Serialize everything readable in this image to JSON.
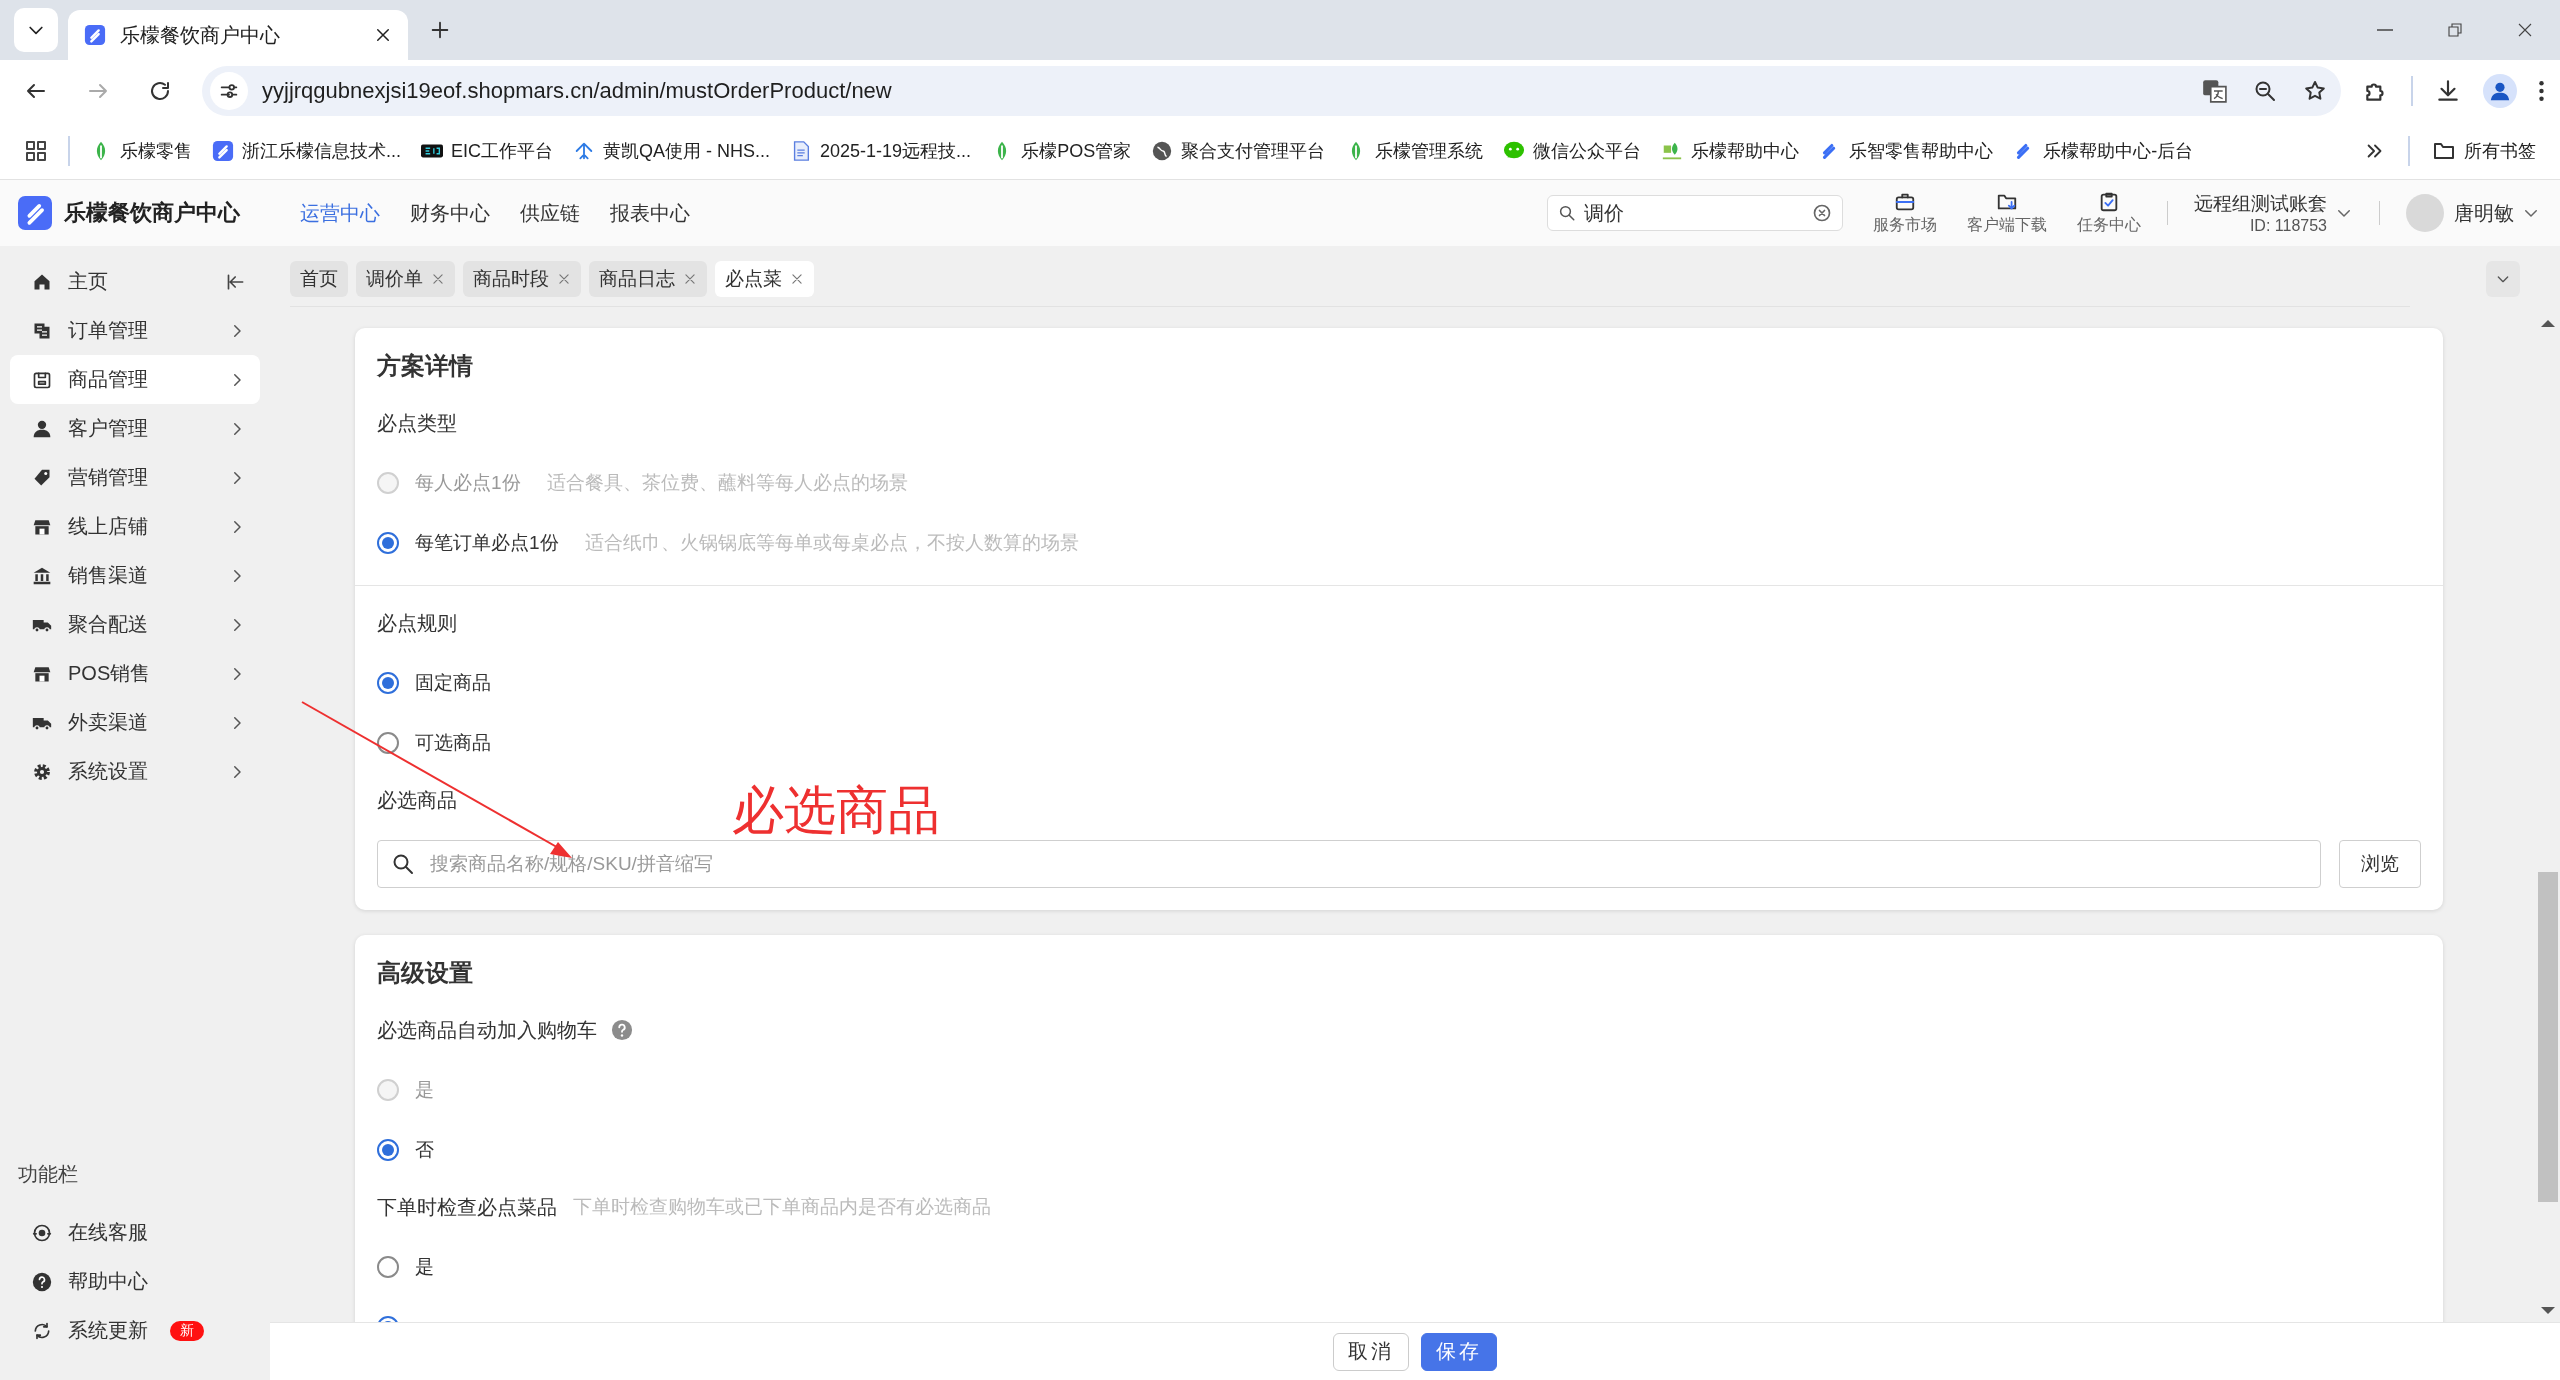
{
  "browser": {
    "tabs": [
      {
        "title": "乐檬餐饮商户中心",
        "selected": true
      }
    ],
    "url": "yyjjrqgubnexjsi19eof.shopmars.cn/admin/mustOrderProduct/new",
    "bookmarks": [
      "乐檬零售",
      "浙江乐檬信息技术...",
      "EIC工作平台",
      "黄凯QA使用 - NHS...",
      "2025-1-19远程技...",
      "乐檬POS管家",
      "聚合支付管理平台",
      "乐檬管理系统",
      "微信公众平台",
      "乐檬帮助中心",
      "乐智零售帮助中心",
      "乐檬帮助中心-后台"
    ],
    "all_bookmarks": "所有书签"
  },
  "header": {
    "brand": "乐檬餐饮商户中心",
    "nav": [
      {
        "label": "运营中心",
        "selected": true
      },
      {
        "label": "财务中心",
        "selected": false
      },
      {
        "label": "供应链",
        "selected": false
      },
      {
        "label": "报表中心",
        "selected": false
      }
    ],
    "search": {
      "value": "调价"
    },
    "tools": [
      "服务市场",
      "客户端下载",
      "任务中心"
    ],
    "account": {
      "name": "远程组测试账套",
      "id": "ID: 118753"
    },
    "user": "唐明敏"
  },
  "sidebar": {
    "items": [
      {
        "label": "主页",
        "kind": "link",
        "selected": false
      },
      {
        "label": "订单管理",
        "kind": "menu",
        "selected": false
      },
      {
        "label": "商品管理",
        "kind": "menu",
        "selected": true
      },
      {
        "label": "客户管理",
        "kind": "menu",
        "selected": false
      },
      {
        "label": "营销管理",
        "kind": "menu",
        "selected": false
      },
      {
        "label": "线上店铺",
        "kind": "menu",
        "selected": false
      },
      {
        "label": "销售渠道",
        "kind": "menu",
        "selected": false
      },
      {
        "label": "聚合配送",
        "kind": "menu",
        "selected": false
      },
      {
        "label": "POS销售",
        "kind": "menu",
        "selected": false
      },
      {
        "label": "外卖渠道",
        "kind": "menu",
        "selected": false
      },
      {
        "label": "系统设置",
        "kind": "menu",
        "selected": false
      }
    ],
    "section_title": "功能栏",
    "footer_items": [
      {
        "label": "在线客服"
      },
      {
        "label": "帮助中心"
      },
      {
        "label": "系统更新",
        "badge": "新"
      }
    ]
  },
  "page_tabs": [
    {
      "label": "首页",
      "selected": false,
      "closable": false
    },
    {
      "label": "调价单",
      "selected": false,
      "closable": true
    },
    {
      "label": "商品时段",
      "selected": false,
      "closable": true
    },
    {
      "label": "商品日志",
      "selected": false,
      "closable": true
    },
    {
      "label": "必点菜",
      "selected": true,
      "closable": true
    }
  ],
  "cards": [
    {
      "title": "方案详情",
      "groups": [
        {
          "kind": "radio_group",
          "label": "必点类型",
          "options": [
            {
              "label": "每人必点1份",
              "hint": "适合餐具、茶位费、蘸料等每人必点的场景",
              "selected": false,
              "disabled": true
            },
            {
              "label": "每笔订单必点1份",
              "hint": "适合纸巾、火锅锅底等每单或每桌必点，不按人数算的场景",
              "selected": true,
              "disabled": false
            }
          ]
        },
        {
          "kind": "divider"
        },
        {
          "kind": "radio_group",
          "label": "必点规则",
          "options": [
            {
              "label": "固定商品",
              "selected": true,
              "disabled": false
            },
            {
              "label": "可选商品",
              "selected": false,
              "disabled": false
            }
          ]
        },
        {
          "kind": "product_picker",
          "label": "必选商品",
          "placeholder": "搜索商品名称/规格/SKU/拼音缩写",
          "button": "浏览"
        }
      ]
    },
    {
      "title": "高级设置",
      "groups": [
        {
          "kind": "radio_group",
          "label": "必选商品自动加入购物车",
          "help": true,
          "options": [
            {
              "label": "是",
              "selected": false,
              "disabled": true
            },
            {
              "label": "否",
              "selected": true,
              "disabled": false
            }
          ]
        },
        {
          "kind": "radio_group",
          "label": "下单时检查必点菜品",
          "hint": "下单时检查购物车或已下单商品内是否有必选商品",
          "options": [
            {
              "label": "是",
              "selected": false,
              "disabled": false
            },
            {
              "selected": true,
              "disabled": false
            }
          ]
        }
      ]
    }
  ],
  "footer_buttons": [
    {
      "label": "取消",
      "primary": false
    },
    {
      "label": "保存",
      "primary": true
    }
  ],
  "annotation": {
    "text": "必选商品"
  }
}
